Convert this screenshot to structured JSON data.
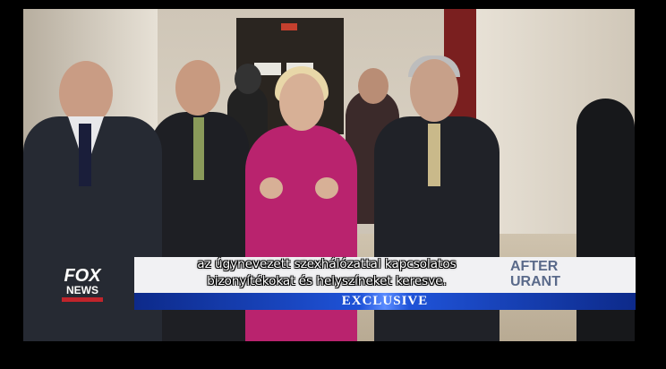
{
  "video": {
    "subtitles": [
      "az úgynevezett szexhálózattal kapcsolatos",
      "bizonyítékokat és helyszíneket keresve."
    ]
  },
  "lower_third": {
    "behind_text": [
      "AFTER",
      "URANT"
    ],
    "banner": "EXCLUSIVE"
  },
  "logo": {
    "line1": "FOX",
    "line2": "NEWS",
    "icon": "fox-news-logo"
  },
  "colors": {
    "banner_blue": "#1f53d8",
    "logo_red": "#c0242b",
    "magenta_jacket": "#b9236e"
  }
}
